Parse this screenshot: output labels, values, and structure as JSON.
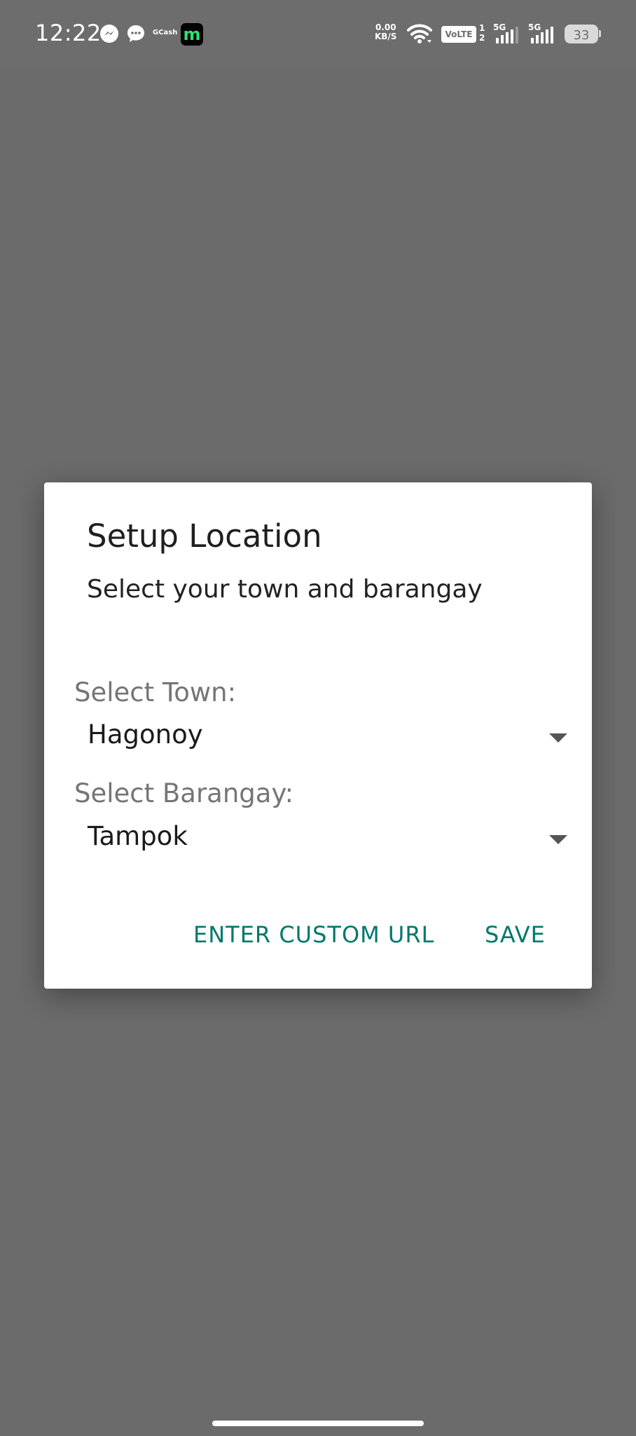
{
  "status_bar": {
    "time": "12:22",
    "gcash_label": "GCash",
    "app_icon_letter": "m",
    "app_icon_color": "#2de36b",
    "net_speed_value": "0.00",
    "net_speed_unit": "KB/S",
    "volte_label": "VoLTE",
    "sim_slot_1": "1",
    "sim_slot_2": "2",
    "signal_1_label": "5G",
    "signal_2_label": "5G",
    "battery_level": "33",
    "icons": [
      "messenger-icon",
      "chat-bubble-icon",
      "wifi-icon",
      "signal-icon",
      "battery-icon"
    ]
  },
  "dialog": {
    "title": "Setup Location",
    "subtitle": "Select your town and barangay",
    "town_label": "Select Town:",
    "town_value": "Hagonoy",
    "barangay_label": "Select Barangay:",
    "barangay_value": "Tampok",
    "custom_url_button": "ENTER CUSTOM URL",
    "save_button": "SAVE",
    "accent_color": "#00786a"
  }
}
